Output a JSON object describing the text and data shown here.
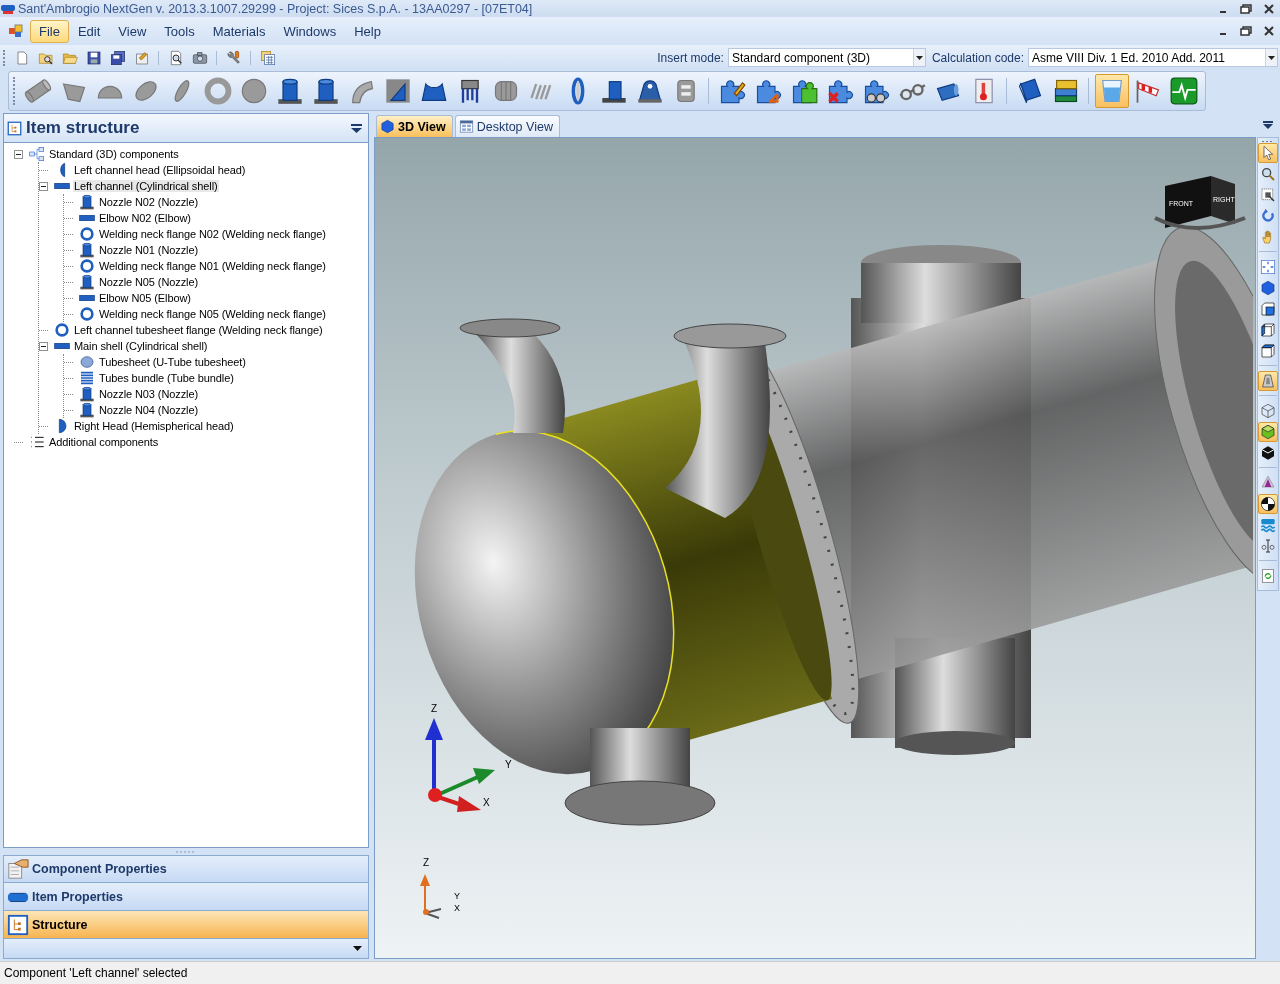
{
  "window": {
    "title": "Sant'Ambrogio NextGen  v. 2013.3.1007.29299 - Project: Sices S.p.A. - 13AA0297 - [07ET04]"
  },
  "menu": [
    {
      "label": "File",
      "selected": true
    },
    {
      "label": "Edit",
      "selected": false
    },
    {
      "label": "View",
      "selected": false
    },
    {
      "label": "Tools",
      "selected": false
    },
    {
      "label": "Materials",
      "selected": false
    },
    {
      "label": "Windows",
      "selected": false
    },
    {
      "label": "Help",
      "selected": false
    }
  ],
  "file_toolbar": [
    {
      "kind": "new"
    },
    {
      "kind": "find"
    },
    {
      "kind": "open"
    },
    {
      "kind": "save"
    },
    {
      "kind": "saveall"
    },
    {
      "kind": "export"
    },
    {
      "kind": "separator"
    },
    {
      "kind": "preview"
    },
    {
      "kind": "camera"
    },
    {
      "kind": "separator"
    },
    {
      "kind": "tools"
    },
    {
      "kind": "separator"
    },
    {
      "kind": "calculator"
    }
  ],
  "insert_mode": {
    "label": "Insert mode:",
    "value": "Standard component (3D)"
  },
  "calculation_code": {
    "label": "Calculation code:",
    "value": "Asme VIII Div. 1 Ed. 2010 Add. 2011"
  },
  "component_toolbar": [
    {
      "kind": "shell",
      "on": false
    },
    {
      "kind": "cone",
      "on": false
    },
    {
      "kind": "head",
      "on": false
    },
    {
      "kind": "oval",
      "on": false
    },
    {
      "kind": "disc",
      "on": false
    },
    {
      "kind": "flange",
      "on": false
    },
    {
      "kind": "plate",
      "on": false
    },
    {
      "kind": "nozzle",
      "on": false
    },
    {
      "kind": "nozzle",
      "on": false
    },
    {
      "kind": "elbow",
      "on": false
    },
    {
      "kind": "bracket",
      "on": false
    },
    {
      "kind": "saddle",
      "on": false
    },
    {
      "kind": "legs",
      "on": false
    },
    {
      "kind": "bellows",
      "on": false
    },
    {
      "kind": "coil",
      "on": false
    },
    {
      "kind": "ring",
      "on": false
    },
    {
      "kind": "skirt",
      "on": false
    },
    {
      "kind": "lug",
      "on": false
    },
    {
      "kind": "clip",
      "on": false
    },
    {
      "kind": "separator"
    },
    {
      "kind": "puzzleedit",
      "on": false
    },
    {
      "kind": "puzzlemove",
      "on": false
    },
    {
      "kind": "puzzleadd",
      "on": false
    },
    {
      "kind": "puzzledelete",
      "on": false
    },
    {
      "kind": "puzzlefind",
      "on": false
    },
    {
      "kind": "glasses",
      "on": false
    },
    {
      "kind": "tube",
      "on": false
    },
    {
      "kind": "thermometer",
      "on": false
    },
    {
      "kind": "separator"
    },
    {
      "kind": "book",
      "on": false
    },
    {
      "kind": "books",
      "on": false
    },
    {
      "kind": "separator"
    },
    {
      "kind": "glass",
      "on": true
    },
    {
      "kind": "windsock",
      "on": false
    },
    {
      "kind": "monitor",
      "on": false
    }
  ],
  "item_structure": {
    "title": "Item structure",
    "tree": [
      {
        "label": "Standard (3D) components",
        "kind": "assembly",
        "selected": false,
        "expanded": true,
        "children": [
          {
            "label": "Left channel head (Ellipsoidal head)",
            "kind": "ellipsoidal",
            "selected": false
          },
          {
            "label": "Left channel (Cylindrical shell)",
            "kind": "cylindrical",
            "selected": true,
            "expanded": true,
            "children": [
              {
                "label": "Nozzle N02 (Nozzle)",
                "kind": "nozzle",
                "selected": false
              },
              {
                "label": "Elbow N02 (Elbow)",
                "kind": "bend",
                "selected": false
              },
              {
                "label": "Welding neck flange N02 (Welding neck flange)",
                "kind": "wnflange",
                "selected": false
              },
              {
                "label": "Nozzle N01 (Nozzle)",
                "kind": "nozzle",
                "selected": false
              },
              {
                "label": "Welding neck flange N01 (Welding neck flange)",
                "kind": "wnflange",
                "selected": false
              },
              {
                "label": "Nozzle N05 (Nozzle)",
                "kind": "nozzle",
                "selected": false
              },
              {
                "label": "Elbow N05 (Elbow)",
                "kind": "bend",
                "selected": false
              },
              {
                "label": "Welding neck flange N05 (Welding neck flange)",
                "kind": "wnflange",
                "selected": false
              }
            ]
          },
          {
            "label": "Left channel tubesheet flange (Welding neck flange)",
            "kind": "wnflange",
            "selected": false
          },
          {
            "label": "Main shell (Cylindrical shell)",
            "kind": "cylindrical",
            "selected": false,
            "expanded": true,
            "children": [
              {
                "label": "Tubesheet (U-Tube tubesheet)",
                "kind": "tubesheet",
                "selected": false
              },
              {
                "label": "Tubes bundle (Tube bundle)",
                "kind": "bundle",
                "selected": false
              },
              {
                "label": "Nozzle N03 (Nozzle)",
                "kind": "nozzle",
                "selected": false
              },
              {
                "label": "Nozzle N04 (Nozzle)",
                "kind": "nozzle",
                "selected": false
              }
            ]
          },
          {
            "label": "Right Head (Hemispherical head)",
            "kind": "hemispherical",
            "selected": false
          }
        ]
      },
      {
        "label": "Additional components",
        "kind": "list",
        "selected": false
      }
    ]
  },
  "panels": [
    {
      "label": "Component Properties",
      "kind": "component",
      "selected": false
    },
    {
      "label": "Item Properties",
      "kind": "item",
      "selected": false
    },
    {
      "label": "Structure",
      "kind": "structure",
      "selected": true
    }
  ],
  "tabs": [
    {
      "label": "3D View",
      "kind": "view3d",
      "selected": true
    },
    {
      "label": "Desktop View",
      "kind": "desktop",
      "selected": false
    }
  ],
  "viewport": {
    "view_cube": [
      "FRONT",
      "RIGHT"
    ],
    "triads": [
      [
        "Z",
        "Y",
        "X"
      ],
      [
        "Z",
        "Y",
        "X"
      ]
    ]
  },
  "view_toolbar": [
    {
      "kind": "pointer",
      "on": true
    },
    {
      "kind": "zoom",
      "on": false
    },
    {
      "kind": "zoombox",
      "on": false
    },
    {
      "kind": "rotate",
      "on": false
    },
    {
      "kind": "pan",
      "on": false
    },
    {
      "kind": "separator"
    },
    {
      "kind": "fit",
      "on": false
    },
    {
      "kind": "solidcube",
      "on": false
    },
    {
      "kind": "frontcube",
      "on": false
    },
    {
      "kind": "sidecube",
      "on": false
    },
    {
      "kind": "wirecube",
      "on": false
    },
    {
      "kind": "separator"
    },
    {
      "kind": "perspective",
      "on": true
    },
    {
      "kind": "separator"
    },
    {
      "kind": "wireframe",
      "on": false
    },
    {
      "kind": "shaded",
      "on": true
    },
    {
      "kind": "blackcube",
      "on": false
    },
    {
      "kind": "separator"
    },
    {
      "kind": "light",
      "on": false
    },
    {
      "kind": "contrast",
      "on": true
    },
    {
      "kind": "water",
      "on": false
    },
    {
      "kind": "textcursor",
      "on": false
    },
    {
      "kind": "separator"
    },
    {
      "kind": "refresh",
      "on": false
    }
  ],
  "status_bar": "Component 'Left channel' selected"
}
